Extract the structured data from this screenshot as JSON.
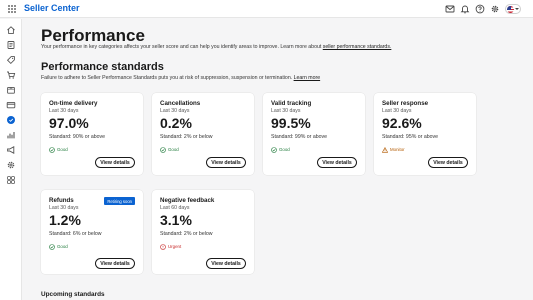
{
  "app": {
    "brand": "Seller Center",
    "accent_color": "#0b63d1",
    "top_icons": [
      "mail-icon",
      "bell-icon",
      "help-icon",
      "settings-icon",
      "us-flag-icon"
    ]
  },
  "sidebar": {
    "items": [
      {
        "icon": "home-icon",
        "active": false
      },
      {
        "icon": "document-icon",
        "active": false
      },
      {
        "icon": "tag-icon",
        "active": false
      },
      {
        "icon": "cart-icon",
        "active": false
      },
      {
        "icon": "box-icon",
        "active": false
      },
      {
        "icon": "card-icon",
        "active": false
      },
      {
        "icon": "performance-icon",
        "active": true
      },
      {
        "icon": "chart-icon",
        "active": false
      },
      {
        "icon": "megaphone-icon",
        "active": false
      },
      {
        "icon": "gear-icon",
        "active": false
      },
      {
        "icon": "apps-icon",
        "active": false
      }
    ]
  },
  "page": {
    "title": "Performance",
    "intro": "Your performance in key categories affects your seller score and can help you identify areas to improve. Learn more about ",
    "intro_link": "seller performance standards.",
    "section_title": "Performance standards",
    "section_desc": "Failure to adhere to Seller Performance Standards puts you at risk of suppression, suspension or termination. ",
    "section_link": "Learn more",
    "upcoming_title": "Upcoming standards"
  },
  "cards": [
    {
      "title": "On-time delivery",
      "period": "Last 30 days",
      "value": "97.0%",
      "standard": "Standard: 90% or above",
      "status": "Good",
      "status_type": "good",
      "button": "View details",
      "tag": ""
    },
    {
      "title": "Cancellations",
      "period": "Last 30 days",
      "value": "0.2%",
      "standard": "Standard: 2% or below",
      "status": "Good",
      "status_type": "good",
      "button": "View details",
      "tag": ""
    },
    {
      "title": "Valid tracking",
      "period": "Last 30 days",
      "value": "99.5%",
      "standard": "Standard: 99% or above",
      "status": "Good",
      "status_type": "good",
      "button": "View details",
      "tag": ""
    },
    {
      "title": "Seller response",
      "period": "Last 30 days",
      "value": "92.6%",
      "standard": "Standard: 95% or above",
      "status": "Monitor",
      "status_type": "monitor",
      "button": "View details",
      "tag": ""
    },
    {
      "title": "Refunds",
      "period": "Last 30 days",
      "value": "1.2%",
      "standard": "Standard: 6% or below",
      "status": "Good",
      "status_type": "good",
      "button": "View details",
      "tag": "Retiring soon"
    },
    {
      "title": "Negative feedback",
      "period": "Last 60 days",
      "value": "3.1%",
      "standard": "Standard: 2% or below",
      "status": "Urgent",
      "status_type": "urgent",
      "button": "View details",
      "tag": ""
    }
  ],
  "colors": {
    "good": "#1f7a3a",
    "urgent": "#c62828",
    "monitor": "#b35a00"
  }
}
